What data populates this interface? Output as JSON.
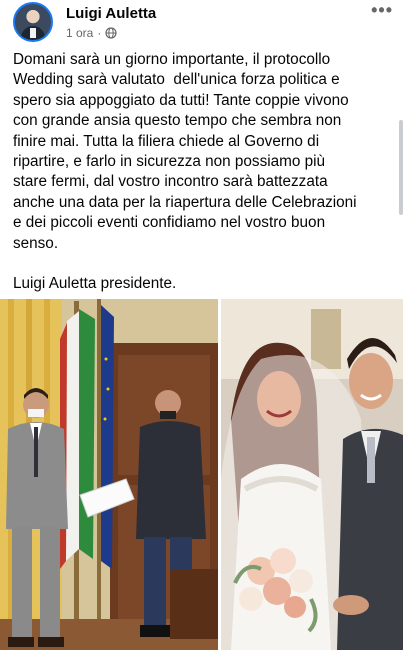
{
  "post": {
    "author": "Luigi Auletta",
    "time": "1 ora",
    "separator": "·",
    "privacy_icon": "globe-icon",
    "more_icon": "more-options-icon",
    "text": "Domani sarà un giorno importante, il protocollo\nWedding sarà valutato  dell'unica forza politica e\nspero sia appoggiato da tutti! Tante coppie vivono\ncon grande ansia questo tempo che sembra non\nfinire mai. Tutta la filiera chiede al Governo di\nripartire, e farlo in sicurezza non possiamo più\nstare fermi, dal vostro incontro sarà battezzata\nanche una data per la riapertura delle Celebrazioni\ne dei piccoli eventi confidiamo nel vostro buon\nsenso.\n\nLuigi Auletta presidente."
  },
  "colors": {
    "accent": "#1877f2",
    "meta_text": "#65676b"
  }
}
